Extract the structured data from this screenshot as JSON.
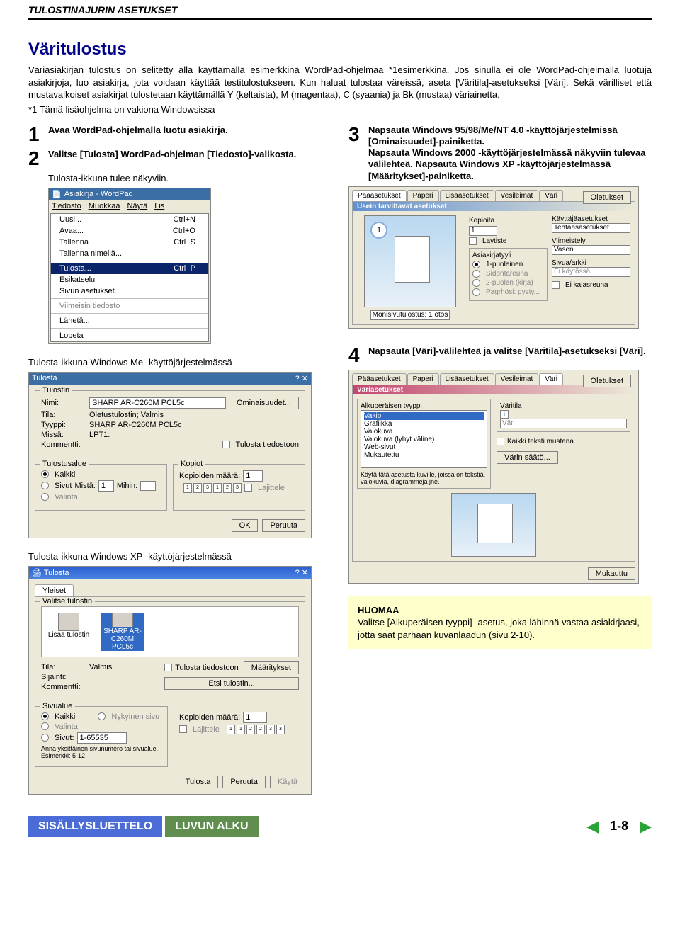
{
  "header": "TULOSTINAJURIN ASETUKSET",
  "title": "Väritulostus",
  "intro": "Väriasiakirjan tulostus on selitetty alla käyttämällä esimerkkinä WordPad-ohjelmaa *1esimerkkinä. Jos sinulla ei ole WordPad-ohjelmalla luotuja asiakirjoja, luo asiakirja, jota voidaan käyttää testitulostukseen. Kun haluat tulostaa väreissä, aseta [Väritila]-asetukseksi [Väri]. Sekä värilliset että mustavalkoiset asiakirjat tulostetaan käyttämällä Y (keltaista), M (magentaa), C (syaania) ja Bk (mustaa) väriainetta.",
  "footnote": "*1    Tämä lisäohjelma on vakiona Windowsissa",
  "steps": {
    "s1": "Avaa WordPad-ohjelmalla luotu asiakirja.",
    "s2": "Valitse [Tulosta] WordPad-ohjelman [Tiedosto]-valikosta.",
    "s2sub": "Tulosta-ikkuna tulee näkyviin.",
    "s3": "Napsauta Windows 95/98/Me/NT 4.0 -käyttöjärjestelmissä [Ominaisuudet]-painiketta.\nNapsauta Windows 2000 -käyttöjärjestelmässä näkyviin tulevaa välilehteä. Napsauta Windows XP -käyttöjärjestelmässä [Määritykset]-painiketta.",
    "s4": "Napsauta [Väri]-välilehteä ja valitse [Väritila]-asetukseksi [Väri]."
  },
  "captions": {
    "me": "Tulosta-ikkuna Windows Me -käyttöjärjestelmässä",
    "xp": "Tulosta-ikkuna Windows XP -käyttöjärjestelmässä"
  },
  "wordpad": {
    "title": "Asiakirja - WordPad",
    "menus": [
      "Tiedosto",
      "Muokkaa",
      "Näytä",
      "Lis"
    ],
    "items": [
      {
        "l": "Uusi...",
        "r": "Ctrl+N"
      },
      {
        "l": "Avaa...",
        "r": "Ctrl+O"
      },
      {
        "l": "Tallenna",
        "r": "Ctrl+S"
      },
      {
        "l": "Tallenna nimellä...",
        "r": ""
      },
      {
        "l": "-",
        "r": ""
      },
      {
        "l": "Tulosta...",
        "r": "Ctrl+P",
        "hl": true
      },
      {
        "l": "Esikatselu",
        "r": ""
      },
      {
        "l": "Sivun asetukset...",
        "r": ""
      },
      {
        "l": "-",
        "r": ""
      },
      {
        "l": "Viimeisin tiedosto",
        "r": "",
        "dis": true
      },
      {
        "l": "-",
        "r": ""
      },
      {
        "l": "Lähetä...",
        "r": ""
      },
      {
        "l": "-",
        "r": ""
      },
      {
        "l": "Lopeta",
        "r": ""
      }
    ]
  },
  "printme": {
    "title": "Tulosta",
    "group_printer": "Tulostin",
    "name": "Nimi:",
    "name_val": "SHARP AR-C260M PCL5c",
    "state": "Tila:",
    "state_val": "Oletustulostin; Valmis",
    "type": "Tyyppi:",
    "type_val": "SHARP AR-C260M PCL5c",
    "where": "Missä:",
    "where_val": "LPT1:",
    "comment": "Kommentti:",
    "props": "Ominaisuudet...",
    "tofile": "Tulosta tiedostoon",
    "range": "Tulostusalue",
    "all": "Kaikki",
    "pages": "Sivut",
    "from": "Mistä:",
    "to": "Mihin:",
    "sel": "Valinta",
    "copies": "Kopiot",
    "num": "Kopioiden määrä:",
    "numval": "1",
    "collate": "Lajittele",
    "ok": "OK",
    "cancel": "Peruuta"
  },
  "printxp": {
    "title": "Tulosta",
    "tab": "Yleiset",
    "group": "Valitse tulostin",
    "add": "Lisää tulostin",
    "printer": "SHARP AR-C260M PCL5c",
    "state": "Tila:",
    "state_val": "Valmis",
    "loc": "Sijainti:",
    "comment": "Kommentti:",
    "tofile": "Tulosta tiedostoon",
    "prefs": "Määritykset",
    "find": "Etsi tulostin...",
    "range": "Sivualue",
    "all": "Kaikki",
    "cur": "Nykyinen sivu",
    "sel": "Valinta",
    "pages": "Sivut:",
    "pages_val": "1-65535",
    "hint": "Anna yksittäinen sivunumero tai sivualue. Esimerkki: 5-12",
    "copies": "Kopioiden määrä:",
    "copies_val": "1",
    "collate": "Lajittele",
    "print": "Tulosta",
    "cancel": "Peruuta",
    "apply": "Käytä"
  },
  "driver1": {
    "tabs": [
      "Pääasetukset",
      "Paperi",
      "Lisäasetukset",
      "Vesileimat",
      "Väri"
    ],
    "panel": "Usein tarvittavat asetukset",
    "bubble": "1",
    "copies": "Kopioita",
    "copies_val": "1",
    "layout": "Laytiste",
    "docstyle": "Asiakirjatyyli",
    "r1": "1-puoleinen",
    "r2": "Sidontareuna",
    "r3": "2-puolen (kirja)",
    "r4": "Pagrhösi: pysty...",
    "userset": "Käyttäjäasetukset",
    "userval": "Tehtäasasetukset",
    "fin": "Viimeistely",
    "fin_val": "Vasen",
    "nup": "Sivua/arkki",
    "nup_val": "Ei käytössä",
    "nostaple": "Ei kajasreuna",
    "mono": "Monisivutulostus",
    "mono_val": "1 otos",
    "defaults": "Oletukset"
  },
  "driver2": {
    "tabs": [
      "Pääasetukset",
      "Paperi",
      "Lisäasetukset",
      "Vesileimat",
      "Väri"
    ],
    "panel": "Väriasetukset",
    "group_type": "Alkuperäisen tyyppi",
    "types": [
      "Vakio",
      "Grafiikka",
      "Valokuva",
      "Valokuva (lyhyt väline)",
      "Web-sivut",
      "Mukautettu"
    ],
    "hint": "Käytä tätä asetusta kuville, joissa on tekstiä, valokuvia, diagrammeja jne.",
    "color_group": "Väritila",
    "color_val": "Väri",
    "auto": "Kaikki teksti mustana",
    "advanced": "Värin säätö...",
    "defaults": "Oletukset",
    "apply": "Mukauttu"
  },
  "note": {
    "title": "HUOMAA",
    "body": "Valitse [Alkuperäisen tyyppi] -asetus, joka lähinnä vastaa asiakirjaasi, jotta saat parhaan kuvanlaadun (sivu 2-10)."
  },
  "footer": {
    "toc": "SISÄLLYSLUETTELO",
    "chap": "LUVUN ALKU",
    "page": "1-8"
  }
}
